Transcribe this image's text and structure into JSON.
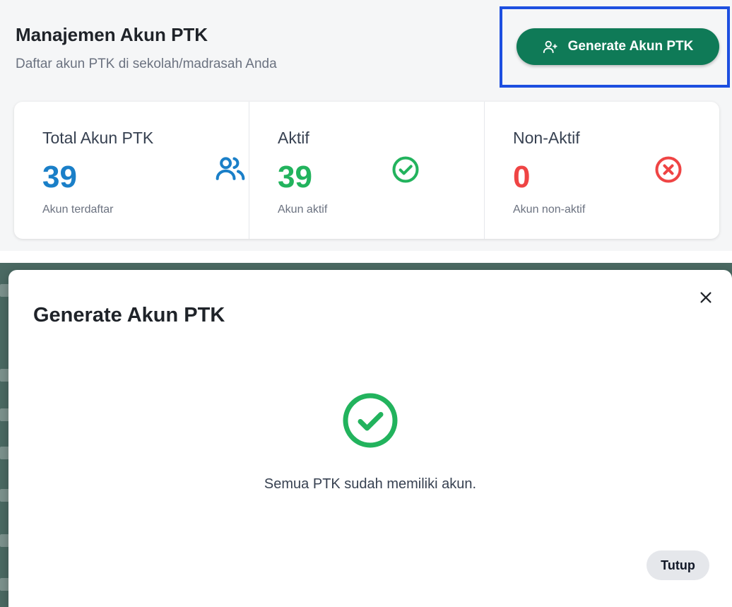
{
  "header": {
    "title": "Manajemen Akun PTK",
    "subtitle": "Daftar akun PTK di sekolah/madrasah Anda",
    "generate_button_label": "Generate Akun PTK"
  },
  "stats": [
    {
      "label": "Total Akun PTK",
      "value": "39",
      "sub": "Akun terdaftar",
      "icon": "users-icon",
      "color": "#1a7fc8"
    },
    {
      "label": "Aktif",
      "value": "39",
      "sub": "Akun aktif",
      "icon": "check-circle-icon",
      "color": "#22b35d"
    },
    {
      "label": "Non-Aktif",
      "value": "0",
      "sub": "Akun non-aktif",
      "icon": "x-circle-icon",
      "color": "#ef4444"
    }
  ],
  "modal": {
    "title": "Generate Akun PTK",
    "message": "Semua PTK sudah memiliki akun.",
    "close_button_label": "Tutup",
    "icon": "success-check-icon"
  },
  "colors": {
    "primary": "#0f7a57",
    "highlight": "#1d4fe0",
    "success": "#22b35d",
    "danger": "#ef4444",
    "info": "#1a7fc8"
  }
}
